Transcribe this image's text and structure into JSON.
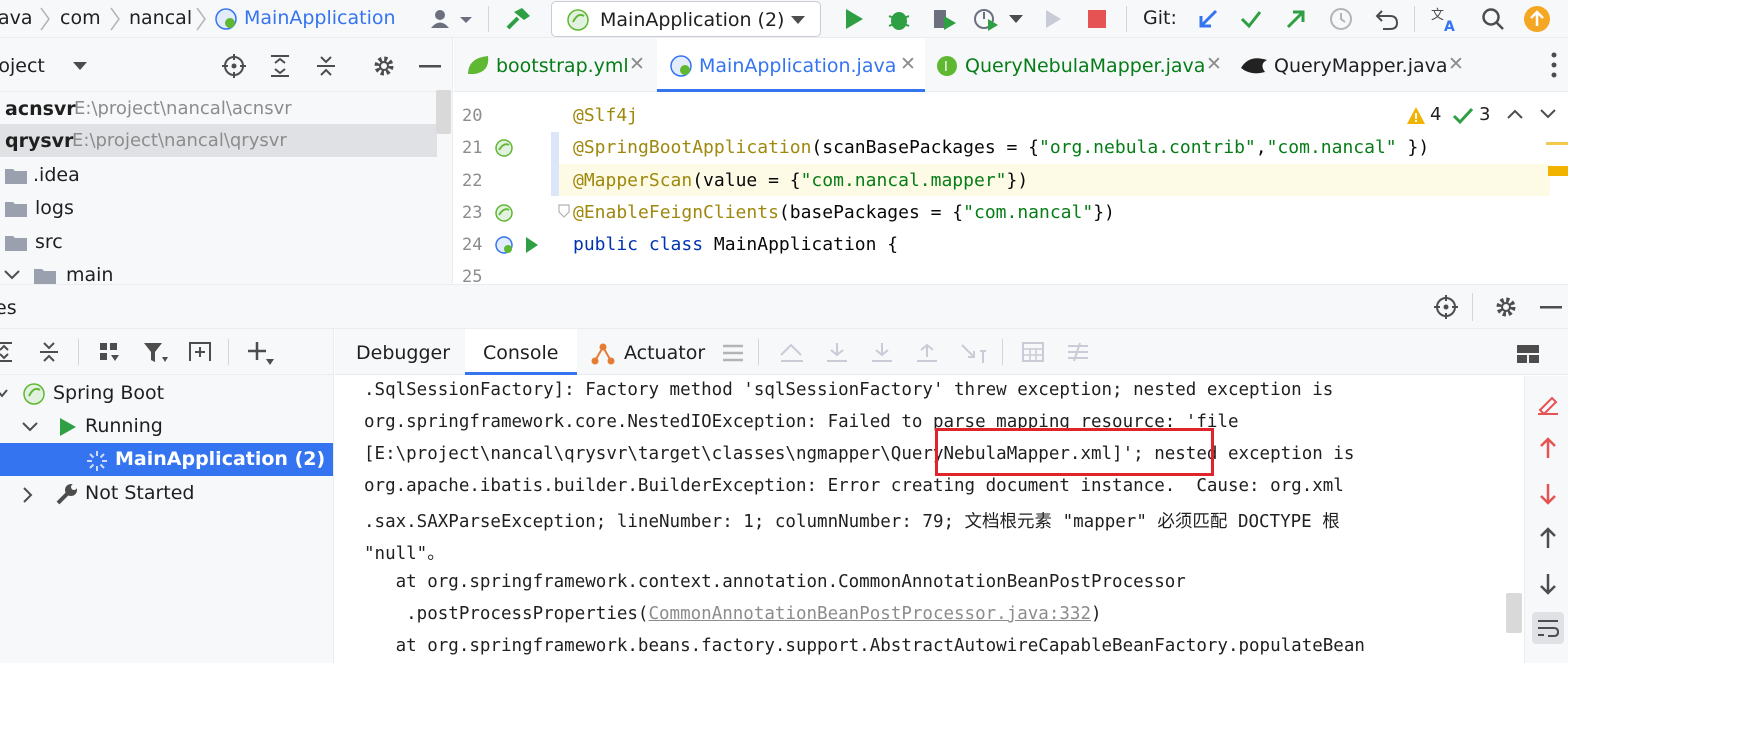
{
  "breadcrumbs": [
    "ava",
    "com",
    "nancal",
    "MainApplication"
  ],
  "run_config": {
    "selected": "MainApplication (2)"
  },
  "git_label": "Git:",
  "project_panel": {
    "title": "roject",
    "tree": [
      {
        "name": "acnsvr",
        "path": "E:\\project\\nancal\\acnsvr"
      },
      {
        "name": "qrysvr",
        "path": "E:\\project\\nancal\\qrysvr"
      },
      {
        "name": ".idea"
      },
      {
        "name": "logs"
      },
      {
        "name": "src"
      },
      {
        "name": "main"
      }
    ]
  },
  "editor": {
    "tabs": [
      {
        "label": "bootstrap.yml",
        "active": false
      },
      {
        "label": "MainApplication.java",
        "active": true
      },
      {
        "label": "QueryNebulaMapper.java",
        "active": false
      },
      {
        "label": "QueryMapper.java",
        "active": false
      }
    ],
    "line_numbers": [
      "20",
      "21",
      "22",
      "23",
      "24",
      "25"
    ],
    "code": {
      "l20_anno": "@Slf4j",
      "l21_anno": "@SpringBootApplication",
      "l21_a": "(scanBasePackages = {",
      "l21_s1": "\"org.nebula.contrib\"",
      "l21_comma": ",",
      "l21_s2": "\"com.nancal\"",
      "l21_end": " })",
      "l22_anno": "@MapperScan",
      "l22_a": "(value = {",
      "l22_s": "\"com.nancal.mapper\"",
      "l22_end": "})",
      "l23_anno": "@EnableFeignClients",
      "l23_a": "(basePackages = {",
      "l23_s": "\"com.nancal\"",
      "l23_end": "})",
      "l24_kw1": "public",
      "l24_kw2": "class",
      "l24_rest": " MainApplication {"
    },
    "warnings": "4",
    "weak_warnings": "3"
  },
  "services": {
    "title": "es",
    "tree": [
      {
        "name": "Spring Boot"
      },
      {
        "name": "Running"
      },
      {
        "name": "MainApplication (2)"
      },
      {
        "name": "Not Started"
      }
    ]
  },
  "console": {
    "tabs": [
      "Debugger",
      "Console",
      "Actuator"
    ],
    "lines": [
      ".SqlSessionFactory]: Factory method 'sqlSessionFactory' threw exception; nested exception is",
      "org.springframework.core.NestedIOException: Failed to parse mapping resource: 'file",
      "[E:\\project\\nancal\\qrysvr\\target\\classes\\ngmapper\\QueryNebulaMapper.xml]'; nested exception is",
      "org.apache.ibatis.builder.BuilderException: Error creating document instance.  Cause: org.xml",
      ".sax.SAXParseException; lineNumber: 1; columnNumber: 79; 文档根元素 \"mapper\" 必须匹配 DOCTYPE 根",
      "\"null\"。",
      "   at org.springframework.context.annotation.CommonAnnotationBeanPostProcessor",
      "   at org.springframework.beans.factory.support.AbstractAutowireCapableBeanFactory.populateBean"
    ],
    "line7_prefix": "    .postProcessProperties(",
    "line7_link": "CommonAnnotationBeanPostProcessor.java:332",
    "line7_suffix": ")"
  },
  "colors": {
    "accent": "#3574f0",
    "highlight": "#e0242b",
    "run_green": "#2ea043",
    "stop_red": "#e55353"
  }
}
